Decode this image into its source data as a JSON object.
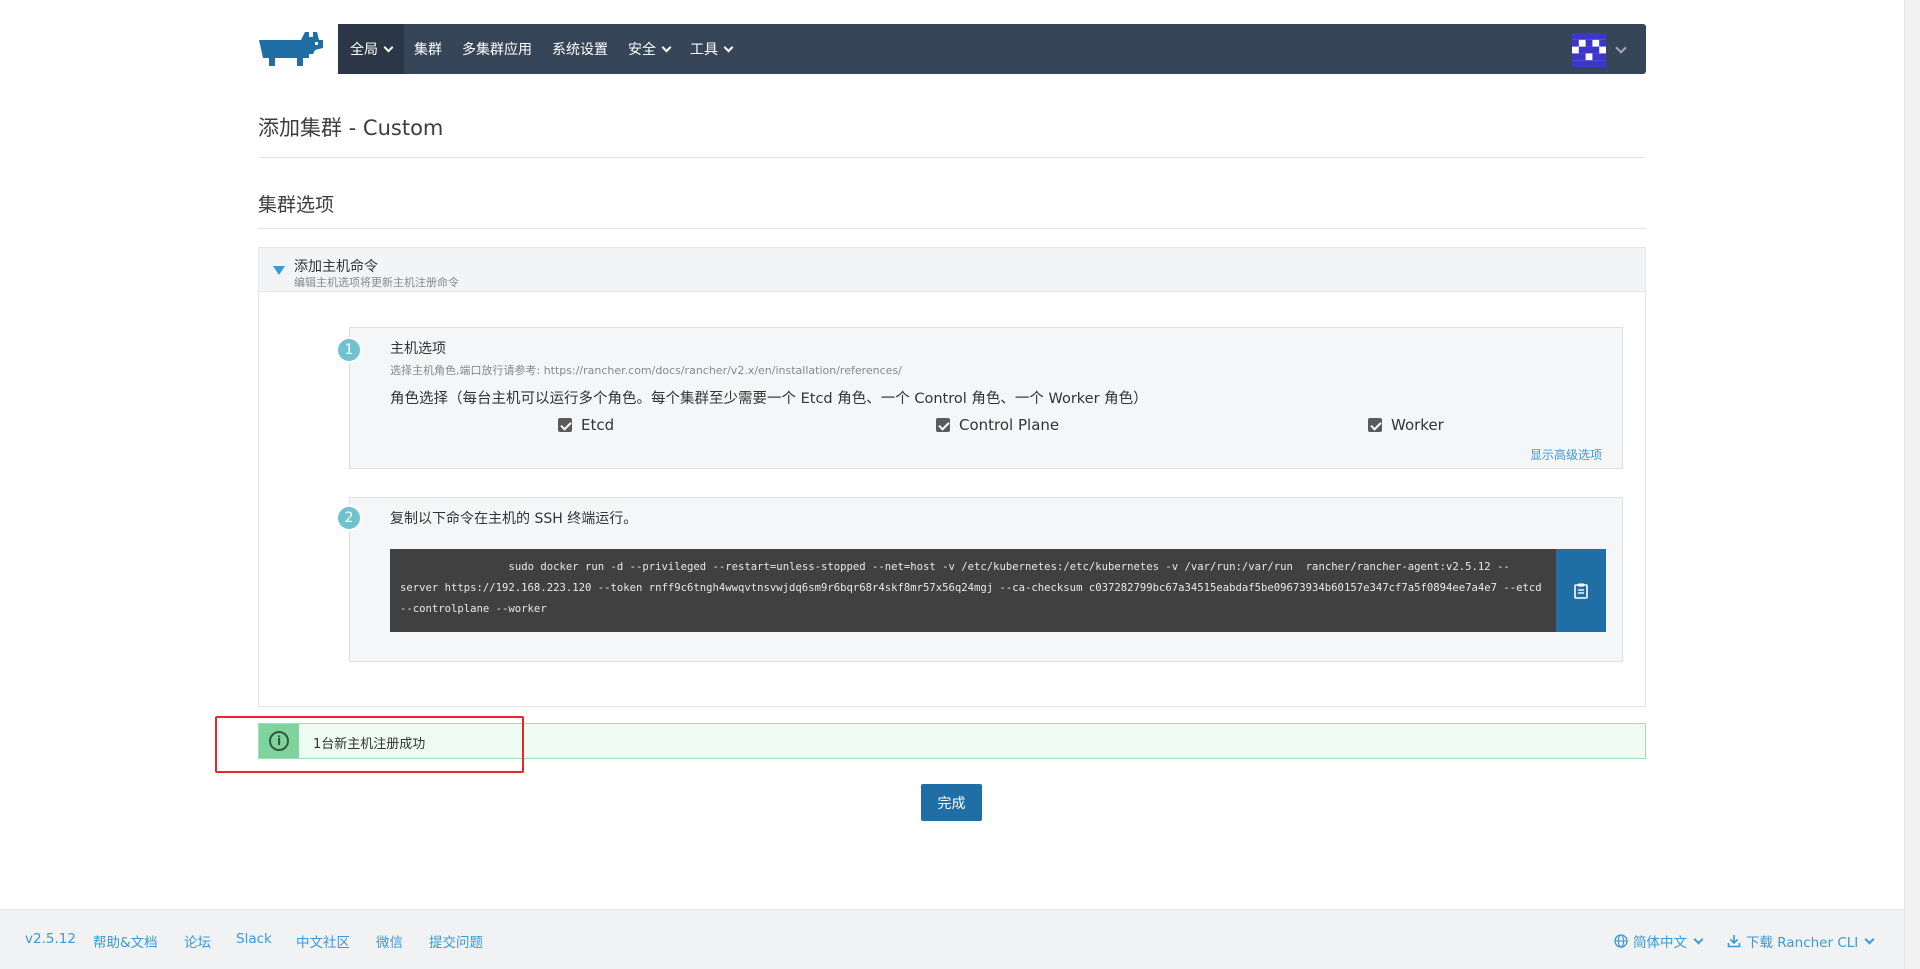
{
  "nav": {
    "items": [
      {
        "label": "全局",
        "has_dropdown": true,
        "active": true
      },
      {
        "label": "集群",
        "has_dropdown": false
      },
      {
        "label": "多集群应用",
        "has_dropdown": false
      },
      {
        "label": "系统设置",
        "has_dropdown": false
      },
      {
        "label": "安全",
        "has_dropdown": true
      },
      {
        "label": "工具",
        "has_dropdown": true
      }
    ],
    "bg_color": "#374558"
  },
  "page": {
    "title": "添加集群 - Custom",
    "section_title": "集群选项"
  },
  "accordion": {
    "title": "添加主机命令",
    "subtitle": "编辑主机选项将更新主机注册命令"
  },
  "step1": {
    "number": "1",
    "title": "主机选项",
    "desc": "选择主机角色,端口放行请参考: https://rancher.com/docs/rancher/v2.x/en/installation/references/",
    "role_text": "角色选择（每台主机可以运行多个角色。每个集群至少需要一个 Etcd 角色、一个 Control 角色、一个 Worker 角色）",
    "roles": [
      {
        "label": "Etcd",
        "checked": true
      },
      {
        "label": "Control Plane",
        "checked": true
      },
      {
        "label": "Worker",
        "checked": true
      }
    ],
    "advanced_link": "显示高级选项"
  },
  "step2": {
    "number": "2",
    "title": "复制以下命令在主机的 SSH 终端运行。",
    "command": "                 sudo docker run -d --privileged --restart=unless-stopped --net=host -v /etc/kubernetes:/etc/kubernetes -v /var/run:/var/run  rancher/rancher-agent:v2.5.12 --server https://192.168.223.120 --token rnff9c6tngh4wwqvtnsvwjdq6sm9r6bqr68r4skf8mr57x56q24mgj --ca-checksum c037282799bc67a34515eabdaf5be09673934b60157e347cf7a5f0894ee7a4e7 --etcd --controlplane --worker",
    "copy_icon": "clipboard-icon"
  },
  "alert": {
    "text": "1台新主机注册成功",
    "icon": "info-icon"
  },
  "done_button": "完成",
  "footer": {
    "version": "v2.5.12",
    "links": [
      "帮助&文档",
      "论坛",
      "Slack",
      "中文社区",
      "微信",
      "提交问题"
    ],
    "language": "简体中文",
    "download": "下载 Rancher CLI"
  },
  "colors": {
    "primary": "#1f6fa6",
    "link": "#3d98d3",
    "success_bg": "#eefbf3",
    "success_icon_bg": "#7fd39c",
    "annotation_red": "#e5282a"
  }
}
